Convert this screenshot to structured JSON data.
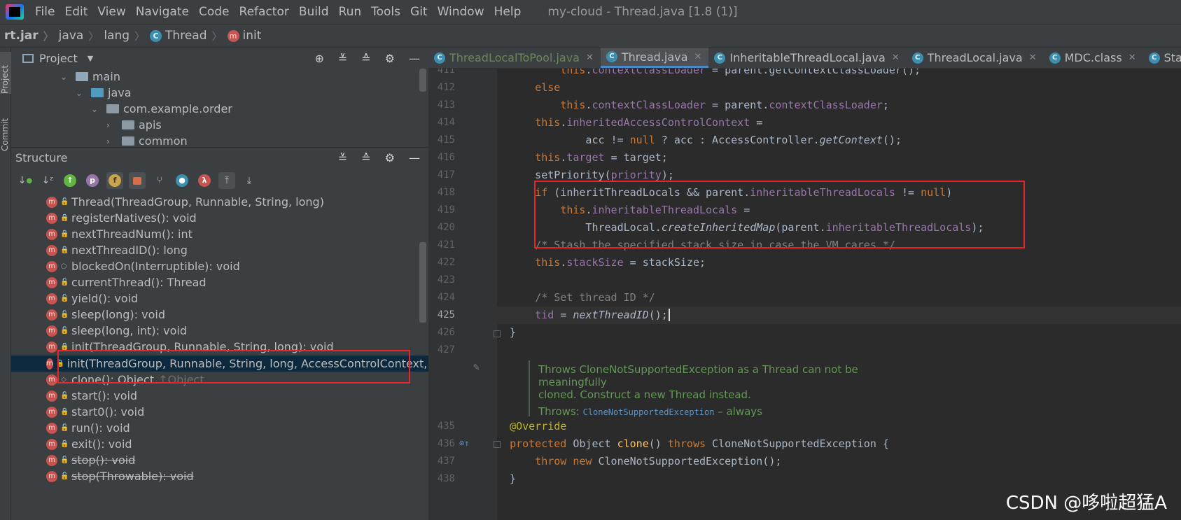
{
  "menubar": {
    "items": [
      "File",
      "Edit",
      "View",
      "Navigate",
      "Code",
      "Refactor",
      "Build",
      "Run",
      "Tools",
      "Git",
      "Window",
      "Help"
    ],
    "title": "my-cloud - Thread.java [1.8 (1)]"
  },
  "breadcrumb": {
    "items": [
      "rt.jar",
      "java",
      "lang",
      "Thread",
      "init"
    ]
  },
  "side_strip": {
    "project": "Project",
    "commit": "Commit"
  },
  "project_panel": {
    "title": "Project",
    "tree": [
      "main",
      "java",
      "com.example.order",
      "apis",
      "common"
    ]
  },
  "structure_panel": {
    "title": "Structure",
    "items": [
      {
        "label": "Thread(ThreadGroup, Runnable, String, long)",
        "vis": "pub"
      },
      {
        "label": "registerNatives(): void",
        "vis": "priv"
      },
      {
        "label": "nextThreadNum(): int",
        "vis": "priv"
      },
      {
        "label": "nextThreadID(): long",
        "vis": "priv"
      },
      {
        "label": "blockedOn(Interruptible): void",
        "vis": "pkg"
      },
      {
        "label": "currentThread(): Thread",
        "vis": "pub"
      },
      {
        "label": "yield(): void",
        "vis": "pub"
      },
      {
        "label": "sleep(long): void",
        "vis": "pub"
      },
      {
        "label": "sleep(long, int): void",
        "vis": "pub"
      },
      {
        "label": "init(ThreadGroup, Runnable, String, long): void",
        "vis": "priv"
      },
      {
        "label": "init(ThreadGroup, Runnable, String, long, AccessControlContext, boolea",
        "vis": "priv"
      },
      {
        "label": "clone(): Object",
        "vis": "priv",
        "suffix": "↑Object"
      },
      {
        "label": "start(): void",
        "vis": "pub"
      },
      {
        "label": "start0(): void",
        "vis": "priv"
      },
      {
        "label": "run(): void",
        "vis": "pub"
      },
      {
        "label": "exit(): void",
        "vis": "priv"
      },
      {
        "label": "stop(): void",
        "vis": "pub"
      },
      {
        "label": "stop(Throwable): void",
        "vis": "pub"
      }
    ]
  },
  "tabs": [
    "ThreadLocalToPool.java",
    "Thread.java",
    "InheritableThreadLocal.java",
    "ThreadLocal.java",
    "MDC.class",
    "Stati"
  ],
  "editor": {
    "line_numbers": [
      "411",
      "412",
      "413",
      "414",
      "415",
      "416",
      "417",
      "418",
      "419",
      "420",
      "421",
      "422",
      "423",
      "424",
      "425",
      "426",
      "427",
      "435",
      "436",
      "437",
      "438"
    ],
    "doc": {
      "text1": "Throws CloneNotSupportedException as a Thread can not be meaningfully",
      "text2": "cloned. Construct a new Thread instead.",
      "throws_label": "Throws:",
      "throws_type": "CloneNotSupportedException",
      "throws_tail": " – always"
    }
  },
  "watermark": "CSDN @哆啦超猛A",
  "colors": {
    "highlight_box": "#e8262a",
    "selection": "#0d293e",
    "keyword": "#cc7832",
    "field": "#9876aa"
  }
}
